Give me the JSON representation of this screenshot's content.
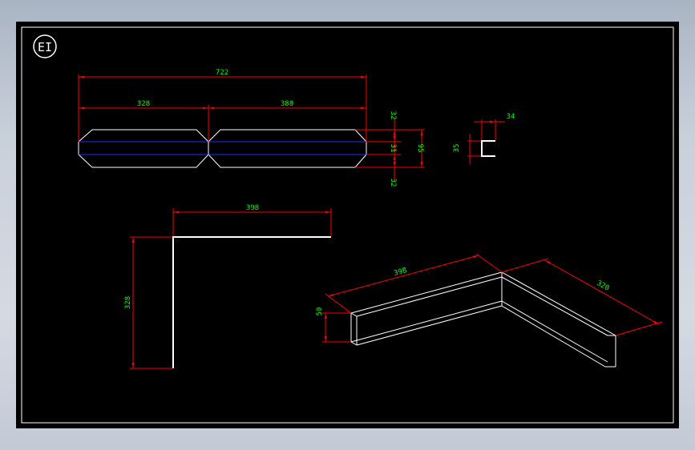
{
  "drawing": {
    "sheet_badge": "EI",
    "colors": {
      "background": "#000000",
      "geometry": "#ffffff",
      "dimension_line": "#ff0000",
      "dimension_text": "#00ff00",
      "center_line": "#0000ff",
      "frame": "#ffffff"
    },
    "flat_pattern": {
      "overall": "722",
      "left_segment": "328",
      "right_segment": "388",
      "top_flange": "32",
      "middle": "31",
      "bottom_flange": "32",
      "total_height": "95"
    },
    "section": {
      "width": "34",
      "height": "35"
    },
    "plan_view": {
      "horizontal_leg": "398",
      "vertical_leg": "328"
    },
    "iso_view": {
      "leg_a": "398",
      "leg_b": "320",
      "height": "50"
    }
  }
}
